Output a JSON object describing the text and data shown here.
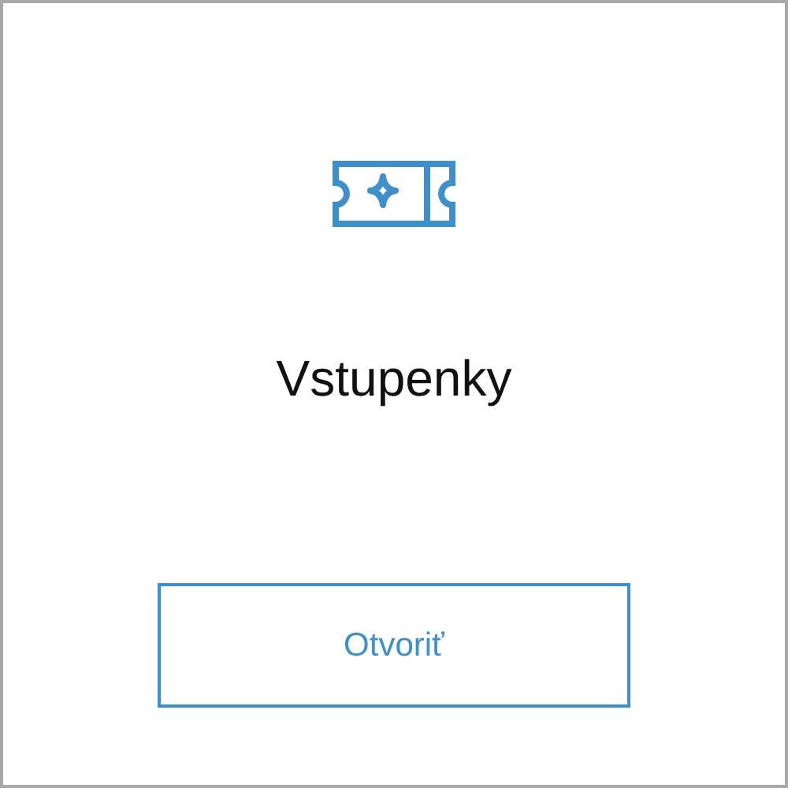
{
  "card": {
    "title": "Vstupenky",
    "button": "Otvoriť"
  }
}
